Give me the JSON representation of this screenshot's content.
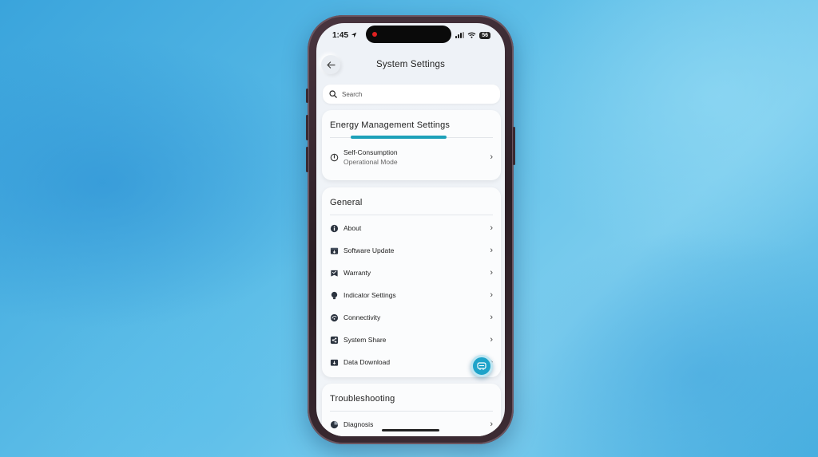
{
  "status_bar": {
    "time": "1:45",
    "battery": "56"
  },
  "header": {
    "title": "System Settings",
    "back_icon": "arrow-left-icon"
  },
  "search": {
    "placeholder": "Search",
    "value": ""
  },
  "energy_card": {
    "title": "Energy Management Settings",
    "mode_name": "Self-Consumption",
    "mode_label": "Operational Mode",
    "accent": "#1da1b9"
  },
  "general_card": {
    "title": "General",
    "items": [
      {
        "label": "About",
        "icon": "info-icon"
      },
      {
        "label": "Software Update",
        "icon": "update-icon"
      },
      {
        "label": "Warranty",
        "icon": "warranty-icon"
      },
      {
        "label": "Indicator Settings",
        "icon": "indicator-icon"
      },
      {
        "label": "Connectivity",
        "icon": "connectivity-icon"
      },
      {
        "label": "System Share",
        "icon": "share-icon"
      },
      {
        "label": "Data Download",
        "icon": "download-icon"
      }
    ]
  },
  "troubleshooting_card": {
    "title": "Troubleshooting",
    "items": [
      {
        "label": "Diagnosis",
        "icon": "diagnosis-icon"
      }
    ]
  },
  "fab": {
    "icon": "chat-bot-icon",
    "color": "#1ea3c9"
  }
}
